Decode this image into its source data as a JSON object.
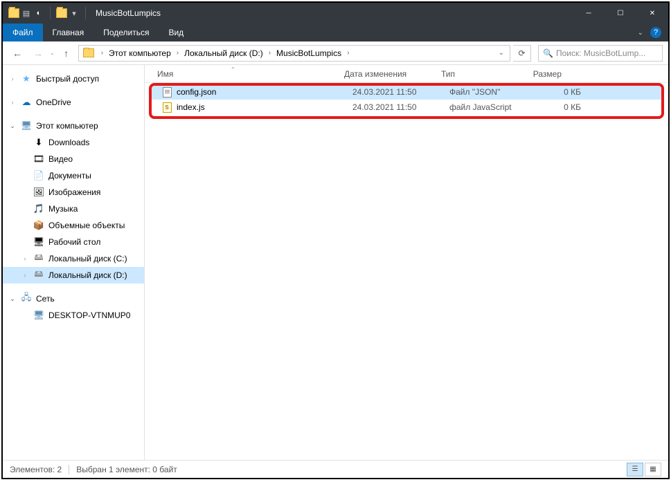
{
  "window": {
    "title": "MusicBotLumpics"
  },
  "ribbon": {
    "file": "Файл",
    "tabs": [
      "Главная",
      "Поделиться",
      "Вид"
    ]
  },
  "breadcrumb": [
    "Этот компьютер",
    "Локальный диск (D:)",
    "MusicBotLumpics"
  ],
  "search": {
    "placeholder": "Поиск: MusicBotLump..."
  },
  "sidebar": {
    "quick_access": "Быстрый доступ",
    "onedrive": "OneDrive",
    "this_pc": "Этот компьютер",
    "pc_children": [
      {
        "icon": "downloads",
        "label": "Downloads"
      },
      {
        "icon": "video",
        "label": "Видео"
      },
      {
        "icon": "docs",
        "label": "Документы"
      },
      {
        "icon": "pics",
        "label": "Изображения"
      },
      {
        "icon": "music",
        "label": "Музыка"
      },
      {
        "icon": "3d",
        "label": "Объемные объекты"
      },
      {
        "icon": "desktop",
        "label": "Рабочий стол"
      },
      {
        "icon": "drive",
        "label": "Локальный диск (C:)"
      },
      {
        "icon": "drive",
        "label": "Локальный диск (D:)"
      }
    ],
    "network": "Сеть",
    "net_children": [
      {
        "icon": "monitor",
        "label": "DESKTOP-VTNMUP0"
      }
    ]
  },
  "columns": {
    "name": "Имя",
    "date": "Дата изменения",
    "type": "Тип",
    "size": "Размер"
  },
  "files": [
    {
      "name": "config.json",
      "date": "24.03.2021 11:50",
      "type": "Файл \"JSON\"",
      "size": "0 КБ",
      "selected": true,
      "icon": "json"
    },
    {
      "name": "index.js",
      "date": "24.03.2021 11:50",
      "type": "файл JavaScript",
      "size": "0 КБ",
      "selected": false,
      "icon": "js"
    }
  ],
  "status": {
    "count": "Элементов: 2",
    "selection": "Выбран 1 элемент: 0 байт"
  }
}
